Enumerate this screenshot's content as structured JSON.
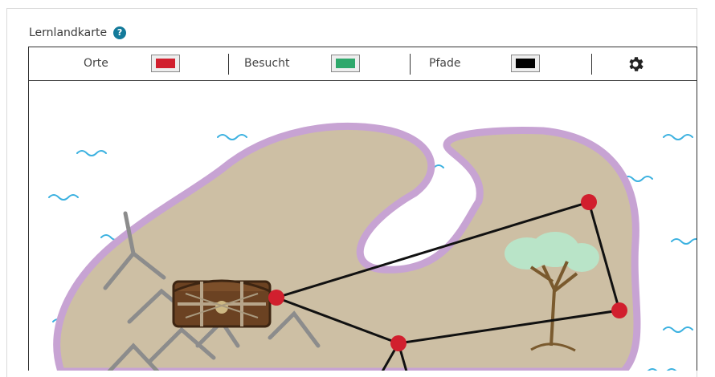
{
  "header": {
    "title": "Lernlandkarte",
    "help_icon": "help-circle-icon"
  },
  "toolbar": {
    "items": [
      {
        "label": "Orte",
        "color": "#d11f2e"
      },
      {
        "label": "Besucht",
        "color": "#2ea86b"
      },
      {
        "label": "Pfade",
        "color": "#000000"
      }
    ],
    "settings_icon": "gear-icon"
  },
  "colors": {
    "land": "#cdbfa4",
    "shore": "#c7a3d3",
    "water_wave": "#3bb1e0",
    "node": "#d11f2e",
    "path": "#111111"
  }
}
